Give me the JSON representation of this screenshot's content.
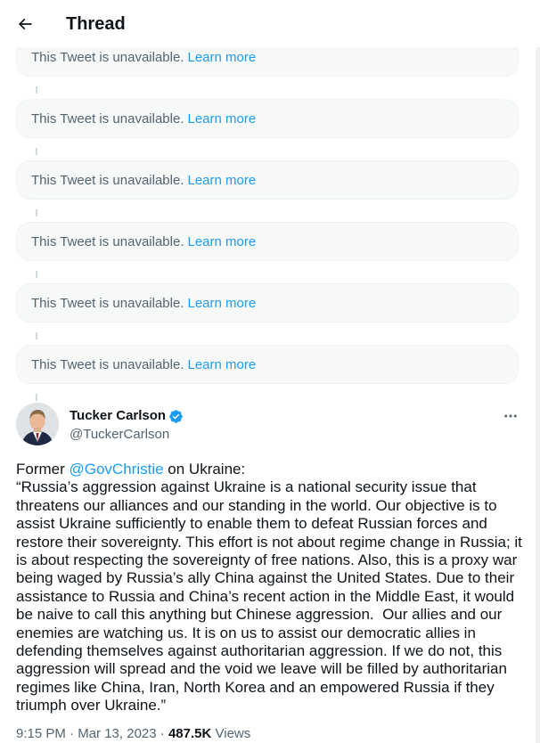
{
  "header": {
    "title": "Thread",
    "back_icon": "arrow-left-icon"
  },
  "unavailable_tweets": [
    {
      "text": "This Tweet is unavailable.",
      "link": "Learn more"
    },
    {
      "text": "This Tweet is unavailable.",
      "link": "Learn more"
    },
    {
      "text": "This Tweet is unavailable.",
      "link": "Learn more"
    },
    {
      "text": "This Tweet is unavailable.",
      "link": "Learn more"
    },
    {
      "text": "This Tweet is unavailable.",
      "link": "Learn more"
    },
    {
      "text": "This Tweet is unavailable.",
      "link": "Learn more"
    }
  ],
  "tweet": {
    "author_name": "Tucker Carlson",
    "handle": "@TuckerCarlson",
    "verified": true,
    "intro_before": "Former ",
    "mention": "@GovChristie",
    "intro_after": " on Ukraine:",
    "body": "“Russia’s aggression against Ukraine is a national security issue that threatens our alliances and our standing in the world. Our objective is to assist Ukraine sufficiently to enable them to defeat Russian forces and restore their sovereignty. This effort is not about regime change in Russia; it is about respecting the sovereignty of free nations. Also, this is a proxy war being waged by Russia’s ally China against the United States. Due to their assistance to Russia and China’s recent action in the Middle East, it would be naive to call this anything but Chinese aggression.  Our allies and our enemies are watching us. It is on us to assist our democratic allies in defending themselves against authoritarian aggression. If we do not, this aggression will spread and the void we leave will be filled by authoritarian regimes like China, Iran, North Korea and an empowered Russia if they triumph over Ukraine.”",
    "time": "9:15 PM",
    "date": "Mar 13, 2023",
    "views_count": "487.5K",
    "views_label": "Views"
  },
  "colors": {
    "link": "#1d9bf0",
    "muted": "#536471",
    "text": "#0f1419",
    "card_bg": "#f7f9f9"
  }
}
